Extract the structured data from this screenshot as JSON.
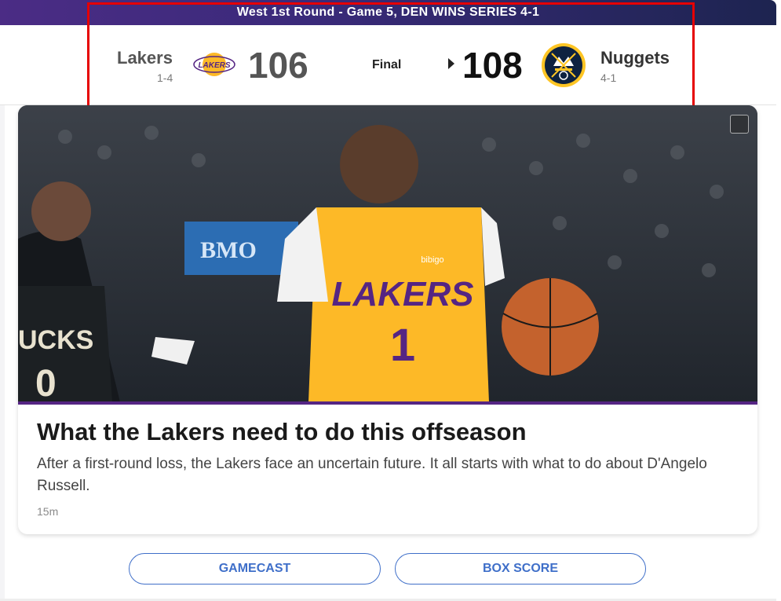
{
  "banner": {
    "text": "West 1st Round - Game 5, DEN WINS SERIES 4-1"
  },
  "game": {
    "status": "Final",
    "away": {
      "name": "Lakers",
      "record": "1-4",
      "score": "106",
      "logo": "lakers-logo",
      "logo_text": "LAKERS",
      "color": "#552583"
    },
    "home": {
      "name": "Nuggets",
      "record": "4-1",
      "score": "108",
      "logo": "nuggets-logo",
      "color": "#0e2240",
      "winner": true
    }
  },
  "article": {
    "title": "What the Lakers need to do this offseason",
    "description": "After a first-round loss, the Lakers face an uncertain future. It all starts with what to do about D'Angelo Russell.",
    "time": "15m",
    "image_signage": "BMO",
    "jersey_text": "LAKERS",
    "jersey_number": "1",
    "opponent_jersey_text": "UCKS",
    "opponent_number": "0",
    "sponsor_text": "bibigo"
  },
  "buttons": {
    "gamecast": "GAMECAST",
    "boxscore": "BOX SCORE"
  },
  "colors": {
    "banner_start": "#4b2c85",
    "banner_end": "#1d2450",
    "accent": "#3f6fc9",
    "highlight": "#e60000"
  }
}
